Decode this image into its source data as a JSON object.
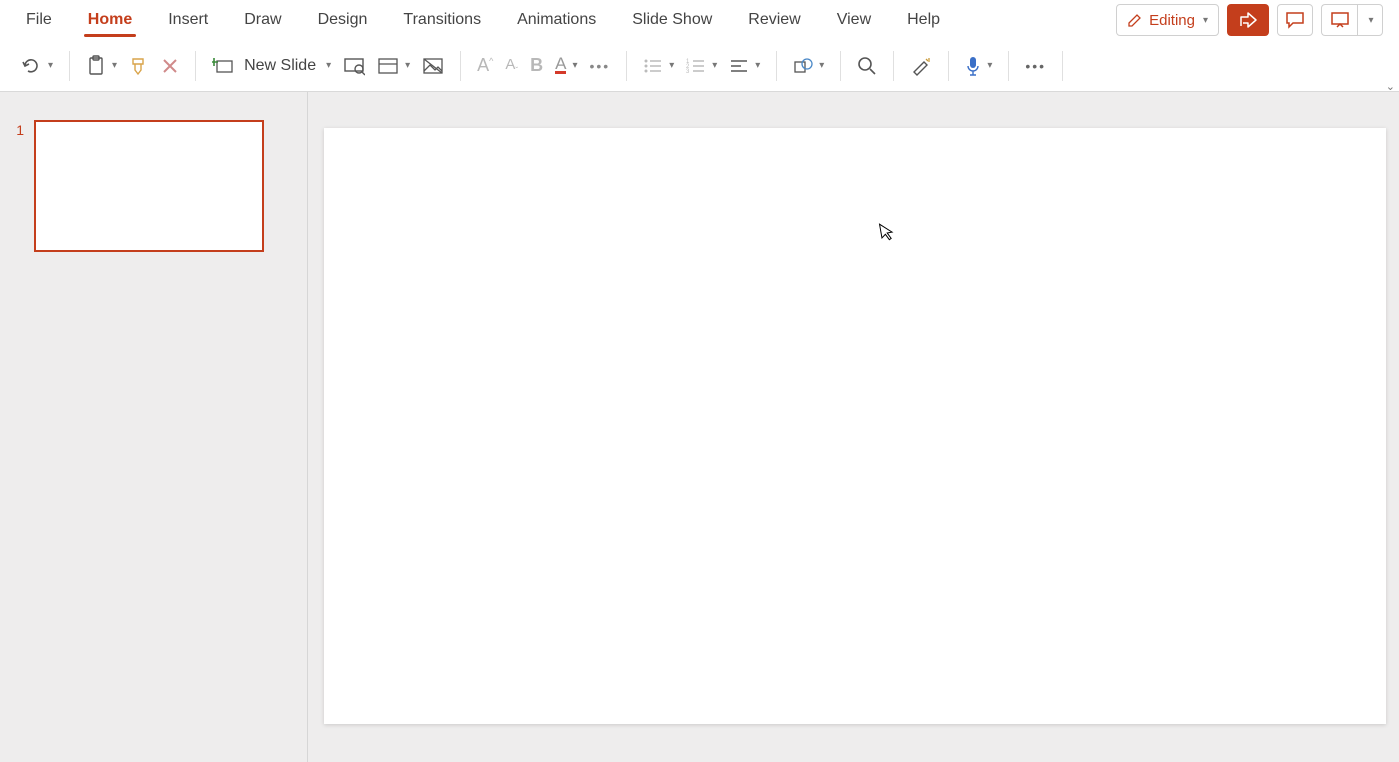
{
  "tabs": {
    "file": "File",
    "home": "Home",
    "insert": "Insert",
    "draw": "Draw",
    "design": "Design",
    "transitions": "Transitions",
    "animations": "Animations",
    "slideshow": "Slide Show",
    "review": "Review",
    "view": "View",
    "help": "Help"
  },
  "header": {
    "editing": "Editing"
  },
  "toolbar": {
    "newSlide": "New Slide"
  },
  "thumbs": {
    "slide1_num": "1"
  }
}
